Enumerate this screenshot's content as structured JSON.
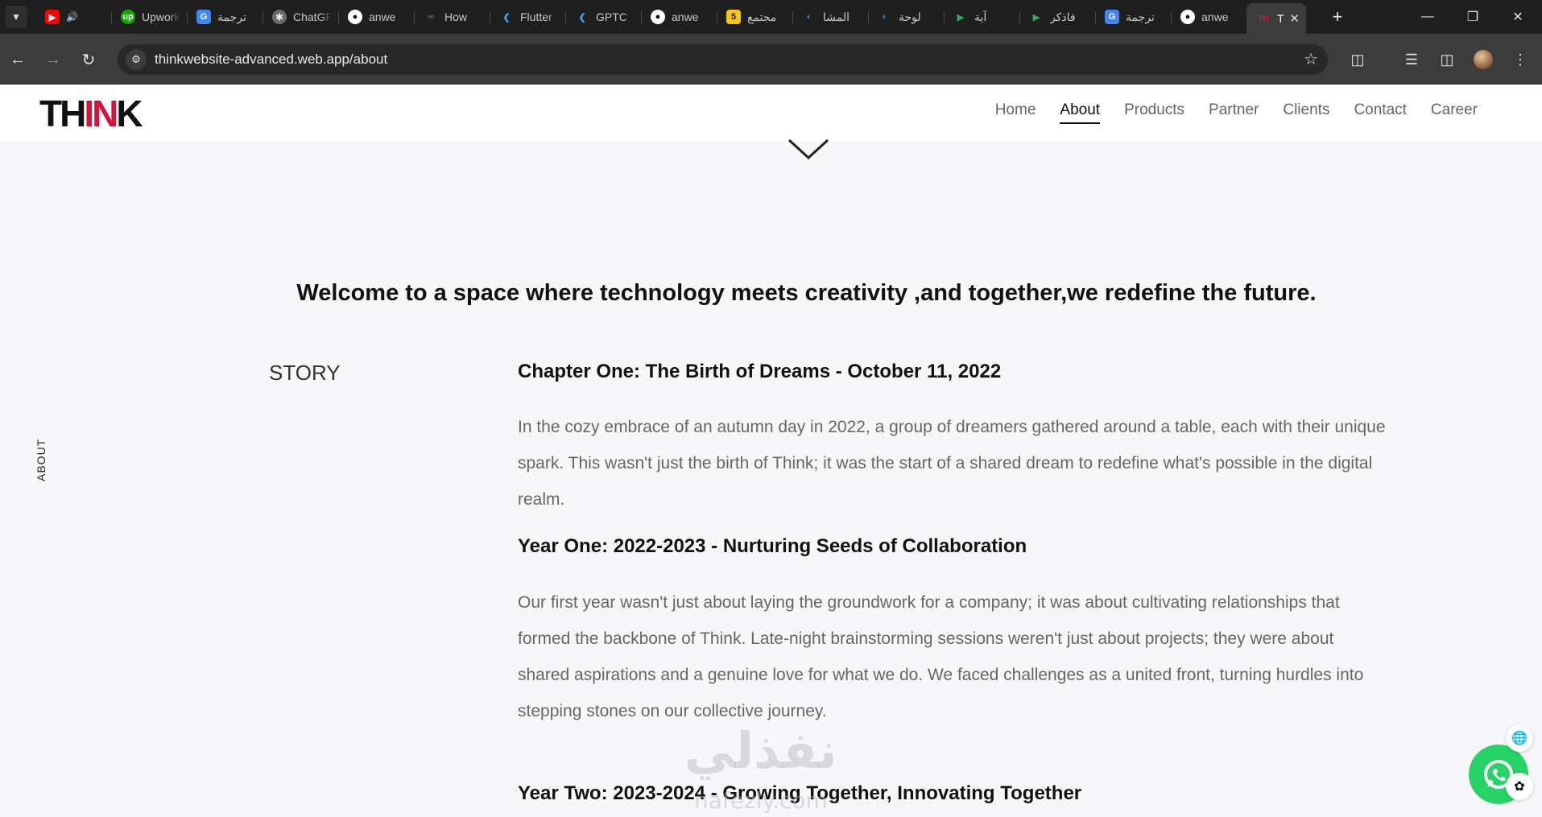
{
  "browser": {
    "tab_search_icon": "chevron-down-icon",
    "tabs": [
      {
        "title": "YouTube",
        "favicon_color": "#ff0000",
        "icon": "youtube-icon"
      },
      {
        "title": "Upwork",
        "favicon_color": "#14a800",
        "icon": "upwork-icon"
      },
      {
        "title": "ترجمة",
        "favicon_color": "#4285f4",
        "icon": "translate-icon"
      },
      {
        "title": "ChatGPT",
        "favicon_color": "#6b6b6b",
        "icon": "chatgpt-icon"
      },
      {
        "title": "anwe",
        "favicon_color": "#ffffff",
        "icon": "github-icon"
      },
      {
        "title": "How",
        "favicon_color": "#2f8d46",
        "icon": "geeksforgeeks-icon"
      },
      {
        "title": "Flutter",
        "favicon_color": "#42a5f5",
        "icon": "flutter-icon"
      },
      {
        "title": "GPTC",
        "favicon_color": "#42a5f5",
        "icon": "flutter-icon"
      },
      {
        "title": "anwe",
        "favicon_color": "#ffffff",
        "icon": "github-icon"
      },
      {
        "title": "مجتمع",
        "favicon_color": "#f5c518",
        "icon": "five-icon"
      },
      {
        "title": "المشا",
        "favicon_color": "#1e88e5",
        "icon": "app-icon"
      },
      {
        "title": "لوحة",
        "favicon_color": "#1e88e5",
        "icon": "app-icon"
      },
      {
        "title": "آية",
        "favicon_color": "#34a853",
        "icon": "google-play-icon"
      },
      {
        "title": "فاذكر",
        "favicon_color": "#34a853",
        "icon": "google-play-icon"
      },
      {
        "title": "ترجمة",
        "favicon_color": "#4285f4",
        "icon": "translate-icon"
      },
      {
        "title": "anwe",
        "favicon_color": "#ffffff",
        "icon": "github-icon"
      }
    ],
    "active_tab": {
      "title": "T",
      "favicon_text": "TH"
    },
    "url": "thinkwebsite-advanced.web.app/about"
  },
  "site": {
    "logo_black_1": "TH",
    "logo_red": "IN",
    "logo_black_2": "K",
    "nav": [
      "Home",
      "About",
      "Products",
      "Partner",
      "Clients",
      "Contact",
      "Career"
    ],
    "active_nav": "About"
  },
  "content": {
    "welcome": "Welcome to a space where technology meets creativity ,and together,we redefine the future.",
    "side_label": "ABOUT",
    "story_label": "STORY",
    "chapters": [
      {
        "title": "Chapter One: The Birth of Dreams - October 11, 2022",
        "text": "In the cozy embrace of an autumn day in 2022, a group of dreamers gathered around a table, each with their unique spark. This wasn't just the birth of Think; it was the start of a shared dream to redefine what's possible in the digital realm."
      },
      {
        "title": "Year One: 2022-2023 - Nurturing Seeds of Collaboration",
        "text": "Our first year wasn't just about laying the groundwork for a company; it was about cultivating relationships that formed the backbone of Think. Late-night brainstorming sessions weren't just about projects; they were about shared aspirations and a genuine love for what we do. We faced challenges as a united front, turning hurdles into stepping stones on our collective journey."
      },
      {
        "title": "Year Two: 2023-2024 - Growing Together, Innovating Together",
        "text": ""
      }
    ]
  },
  "watermark": {
    "arabic": "نفذلي",
    "latin": "nafezly.com"
  },
  "colors": {
    "brand_red": "#d4143a",
    "whatsapp": "#25d366"
  }
}
